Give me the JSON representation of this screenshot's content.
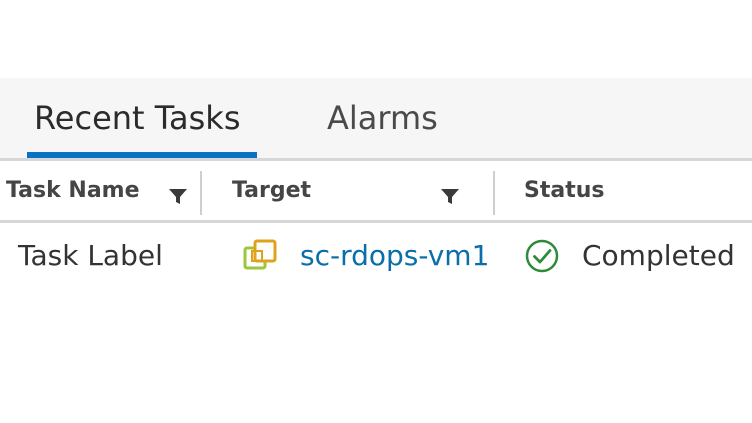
{
  "tabs": [
    {
      "label": "Recent Tasks",
      "active": true
    },
    {
      "label": "Alarms",
      "active": false
    }
  ],
  "columns": {
    "task_name": "Task Name",
    "target": "Target",
    "status": "Status"
  },
  "rows": [
    {
      "task_name": "Task Label",
      "target": "sc-rdops-vm1",
      "status": "Completed",
      "target_icon": "vm-icon",
      "status_icon": "check-circle-icon"
    }
  ],
  "colors": {
    "accent": "#0a72c3",
    "link": "#0a6fa8",
    "success": "#2e8b3a",
    "vm_icon": "#9bc83a"
  }
}
